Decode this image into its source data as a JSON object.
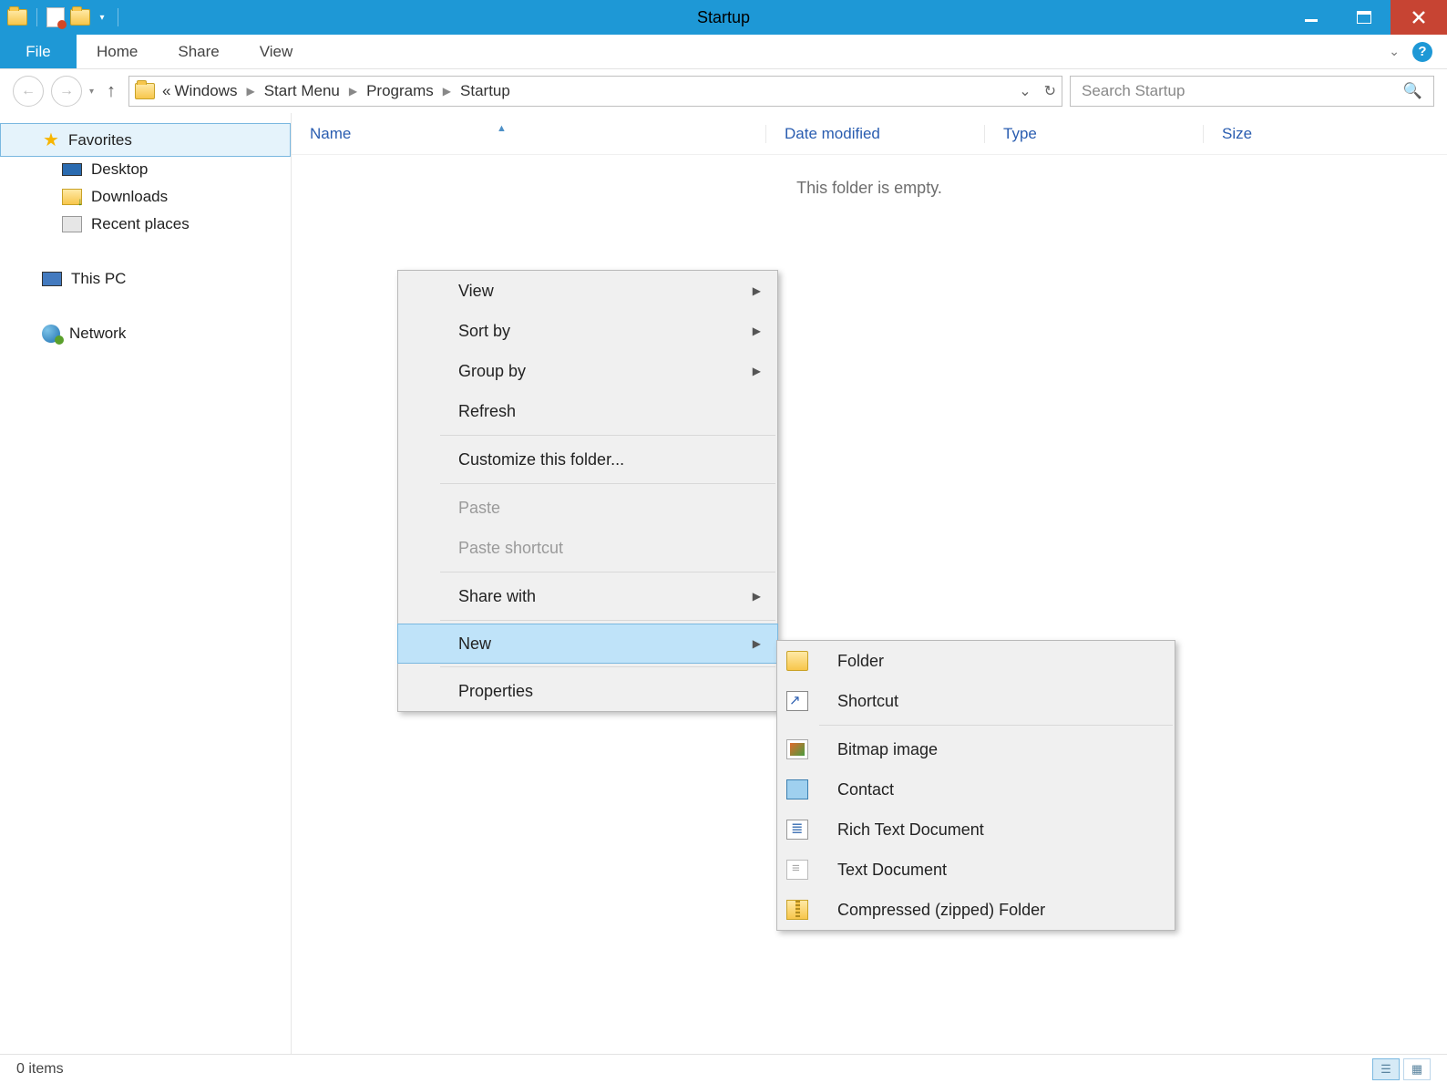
{
  "window": {
    "title": "Startup"
  },
  "ribbon": {
    "file": "File",
    "tabs": [
      "Home",
      "Share",
      "View"
    ]
  },
  "breadcrumb": {
    "overflow": "«",
    "parts": [
      "Windows",
      "Start Menu",
      "Programs",
      "Startup"
    ]
  },
  "search": {
    "placeholder": "Search Startup"
  },
  "sidebar": {
    "favorites_label": "Favorites",
    "favorites": [
      "Desktop",
      "Downloads",
      "Recent places"
    ],
    "this_pc": "This PC",
    "network": "Network"
  },
  "columns": {
    "name": "Name",
    "date": "Date modified",
    "type": "Type",
    "size": "Size"
  },
  "empty": "This folder is empty.",
  "context_menu": {
    "items": [
      {
        "label": "View",
        "arrow": true
      },
      {
        "label": "Sort by",
        "arrow": true
      },
      {
        "label": "Group by",
        "arrow": true
      },
      {
        "label": "Refresh"
      },
      {
        "sep": true
      },
      {
        "label": "Customize this folder..."
      },
      {
        "sep": true
      },
      {
        "label": "Paste",
        "disabled": true
      },
      {
        "label": "Paste shortcut",
        "disabled": true
      },
      {
        "sep": true
      },
      {
        "label": "Share with",
        "arrow": true
      },
      {
        "sep": true
      },
      {
        "label": "New",
        "arrow": true,
        "highlight": true
      },
      {
        "sep": true
      },
      {
        "label": "Properties"
      }
    ]
  },
  "new_submenu": {
    "items": [
      {
        "label": "Folder",
        "icon": "ic-folder"
      },
      {
        "label": "Shortcut",
        "icon": "ic-shortcut"
      },
      {
        "sep": true
      },
      {
        "label": "Bitmap image",
        "icon": "ic-bmp"
      },
      {
        "label": "Contact",
        "icon": "ic-contact"
      },
      {
        "label": "Rich Text Document",
        "icon": "ic-rtf"
      },
      {
        "label": "Text Document",
        "icon": "ic-txt"
      },
      {
        "label": "Compressed (zipped) Folder",
        "icon": "ic-zip"
      }
    ]
  },
  "status": {
    "items": "0 items"
  }
}
